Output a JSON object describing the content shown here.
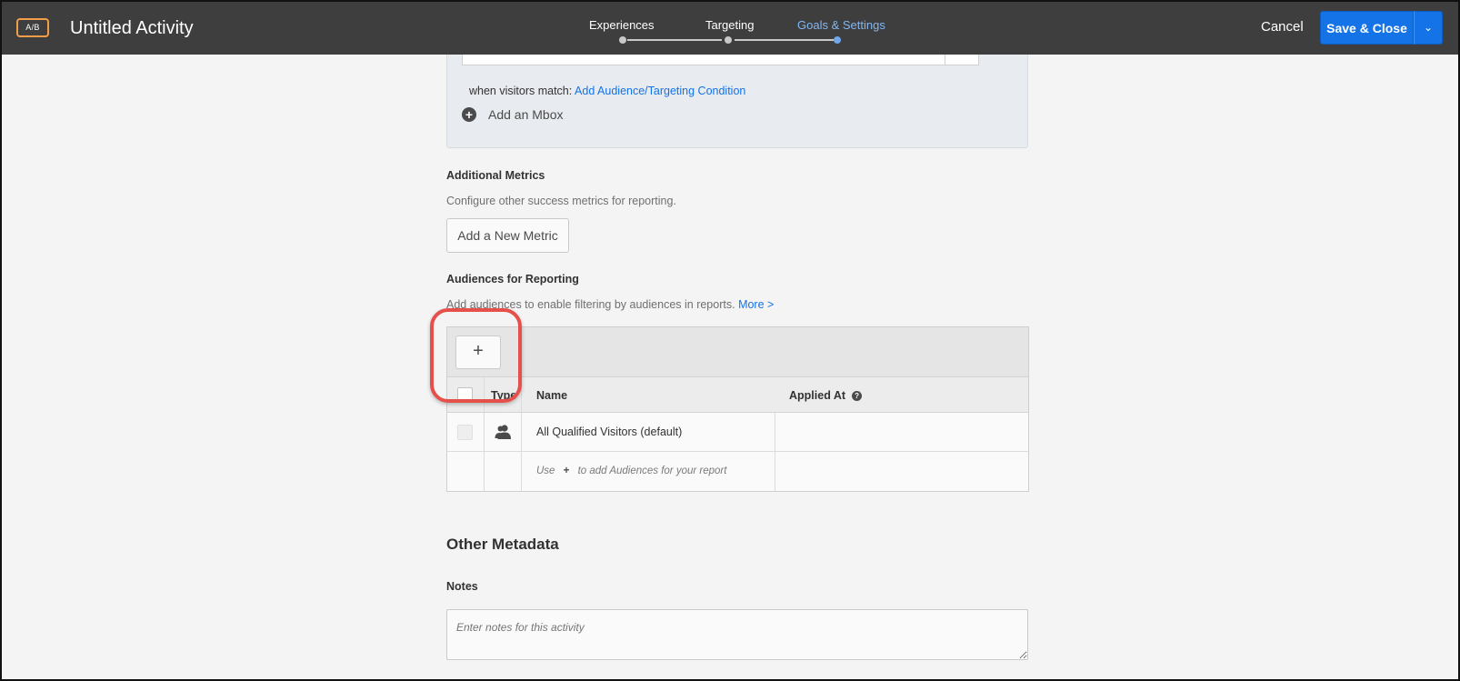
{
  "header": {
    "badge": "A/B",
    "title": "Untitled Activity",
    "steps": [
      {
        "label": "Experiences"
      },
      {
        "label": "Targeting"
      },
      {
        "label": "Goals & Settings"
      }
    ],
    "cancel_label": "Cancel",
    "save_label": "Save & Close",
    "dropdown_glyph": "⌄"
  },
  "goal": {
    "visitors_prefix": "when visitors match:",
    "visitors_link": "Add Audience/Targeting Condition",
    "add_mbox": "Add an Mbox"
  },
  "additional_metrics": {
    "title": "Additional Metrics",
    "description": "Configure other success metrics for reporting.",
    "button": "Add a New Metric"
  },
  "audiences": {
    "title": "Audiences for Reporting",
    "description": "Add audiences to enable filtering by audiences in reports.",
    "more_link": "More >",
    "add_button": "+",
    "columns": {
      "type": "Type",
      "name": "Name",
      "applied_at": "Applied At"
    },
    "rows": [
      {
        "name": "All Qualified Visitors (default)",
        "applied_at": "",
        "icon": "audience-users-icon"
      }
    ],
    "hint_prefix": "Use",
    "hint_plus": "+",
    "hint_suffix": "to add Audiences for your report"
  },
  "other_metadata": {
    "title": "Other Metadata",
    "notes_label": "Notes",
    "notes_placeholder": "Enter notes for this activity"
  },
  "colors": {
    "header_bg": "#3e3e3e",
    "accent_blue": "#1473e6",
    "active_step": "#83b7f1",
    "badge_orange": "#f29d4a",
    "callout_red": "#e5504a"
  }
}
